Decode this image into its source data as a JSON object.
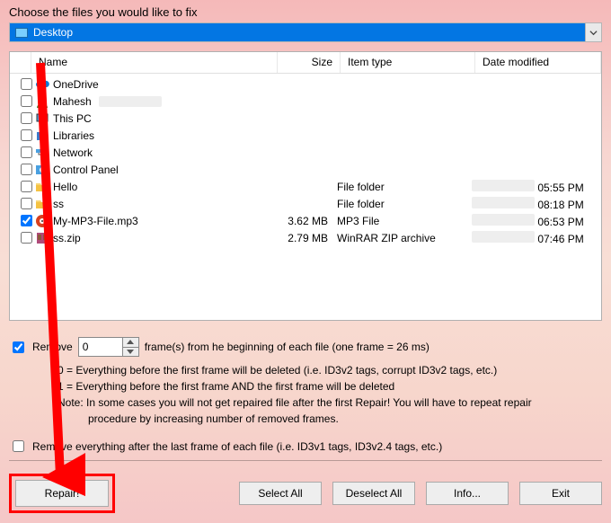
{
  "title": "Choose the files you would like to fix",
  "path": "Desktop",
  "columns": {
    "name": "Name",
    "size": "Size",
    "type": "Item type",
    "date": "Date modified"
  },
  "rows": [
    {
      "icon": "cloud",
      "name": "OneDrive",
      "checked": false
    },
    {
      "icon": "user",
      "name": "Mahesh",
      "checked": false,
      "blurred_ext": true
    },
    {
      "icon": "pc",
      "name": "This PC",
      "checked": false
    },
    {
      "icon": "libs",
      "name": "Libraries",
      "checked": false
    },
    {
      "icon": "net",
      "name": "Network",
      "checked": false
    },
    {
      "icon": "cp",
      "name": "Control Panel",
      "checked": false
    },
    {
      "icon": "folder",
      "name": "Hello",
      "checked": false,
      "type": "File folder",
      "date": "05:55 PM",
      "dblur": true
    },
    {
      "icon": "folder",
      "name": "ss",
      "checked": false,
      "type": "File folder",
      "date": "08:18 PM",
      "dblur": true
    },
    {
      "icon": "mp3",
      "name": "My-MP3-File.mp3",
      "checked": true,
      "size": "3.62 MB",
      "type": "MP3 File",
      "date": "06:53 PM",
      "dblur": true
    },
    {
      "icon": "zip",
      "name": "ss.zip",
      "checked": false,
      "size": "2.79 MB",
      "type": "WinRAR ZIP archive",
      "date": "07:46 PM",
      "dblur": true
    }
  ],
  "remove": {
    "checked": true,
    "label": "Remove",
    "value": "0",
    "suffix": "frame(s) from he beginning of each file (one frame = 26 ms)",
    "line1": "0 = Everything before the first frame will be deleted (i.e. ID3v2 tags, corrupt ID3v2 tags, etc.)",
    "line2": "1 = Everything before the first frame AND the first frame will be deleted",
    "note": "Note: In some cases you will not get repaired file after the first Repair! You will have to repeat repair",
    "note2": "procedure by increasing number of removed frames."
  },
  "remove_after": {
    "checked": false,
    "label": "Remove everything after the last frame of each file (i.e. ID3v1 tags, ID3v2.4 tags, etc.)"
  },
  "buttons": {
    "repair": "Repair!",
    "select_all": "Select All",
    "deselect_all": "Deselect All",
    "info": "Info...",
    "exit": "Exit"
  }
}
